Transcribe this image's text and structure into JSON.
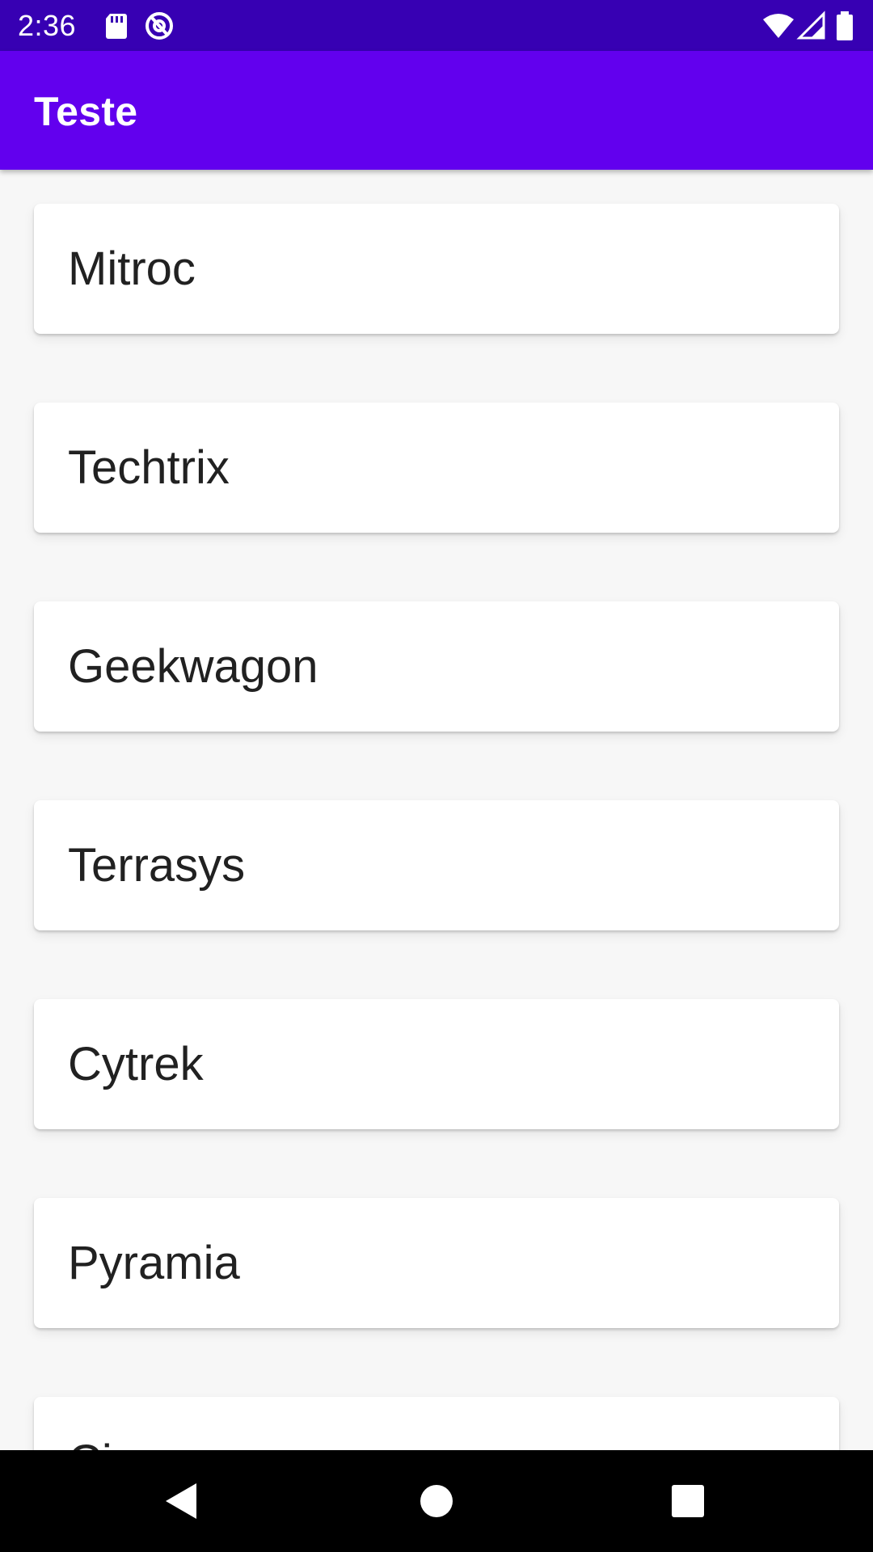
{
  "status_bar": {
    "time": "2:36",
    "color": "#3700B3",
    "left_icons": [
      "sd-card-icon",
      "at-sign-icon"
    ],
    "right_icons": [
      "wifi-icon",
      "cellular-signal-icon",
      "battery-icon"
    ]
  },
  "app_bar": {
    "title": "Teste",
    "color": "#6200EE"
  },
  "list": {
    "items": [
      {
        "label": "Mitroc"
      },
      {
        "label": "Techtrix"
      },
      {
        "label": "Geekwagon"
      },
      {
        "label": "Terrasys"
      },
      {
        "label": "Cytrek"
      },
      {
        "label": "Pyramia"
      },
      {
        "label": "Circ"
      }
    ]
  },
  "nav_bar": {
    "buttons": [
      "back-icon",
      "home-icon",
      "recents-icon"
    ]
  }
}
